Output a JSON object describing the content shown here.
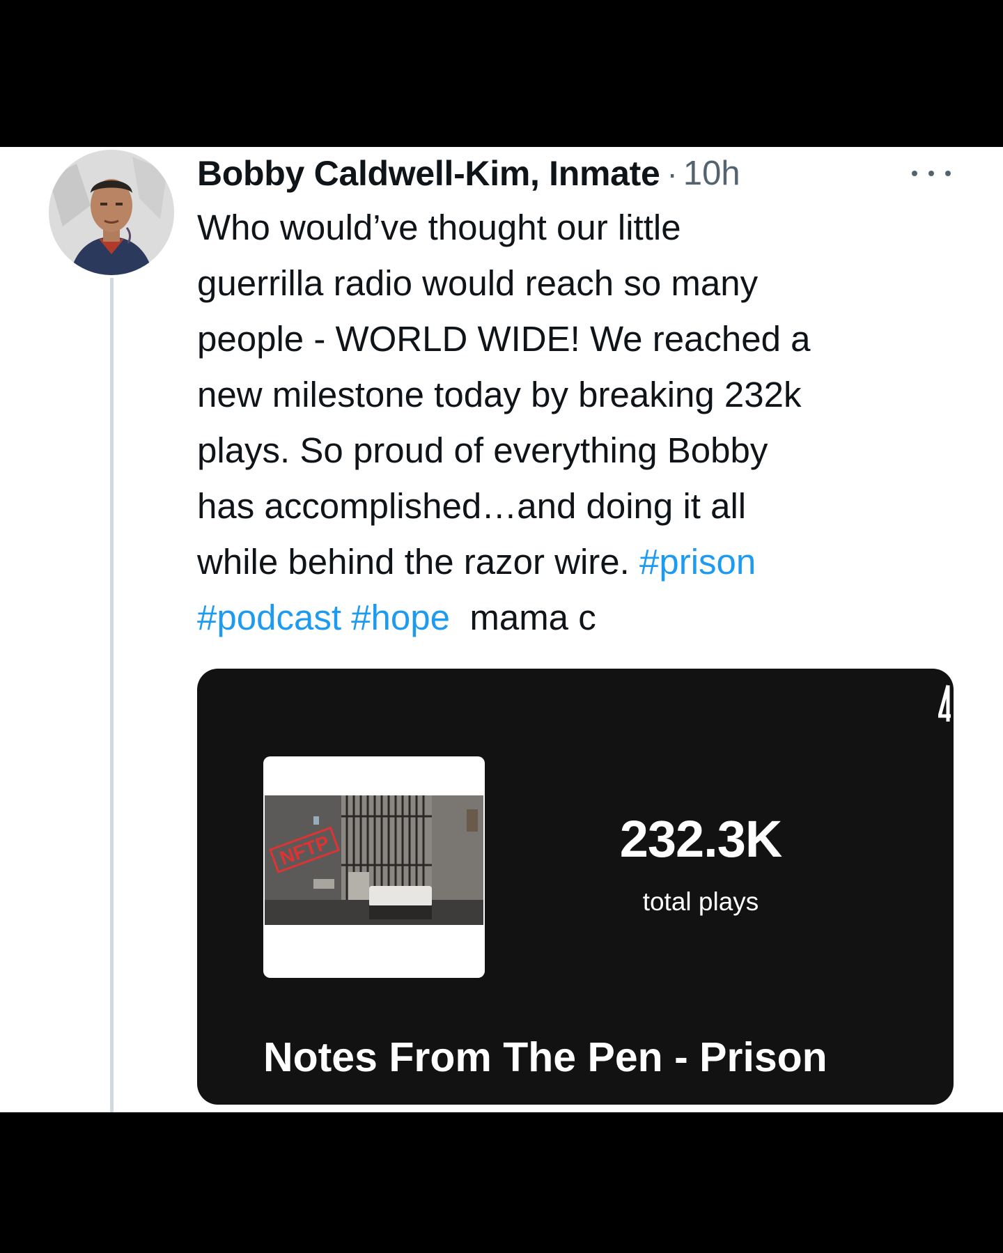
{
  "tweet": {
    "author_name": "Bobby Caldwell-Kim, Inmate",
    "separator": "·",
    "timestamp": "10h",
    "text_lines": [
      "Who would’ve thought our little",
      "guerrilla radio would reach so many",
      "people - WORLD WIDE! We reached a",
      "new milestone today by breaking 232k",
      "plays. So proud of everything Bobby",
      "has accomplished…and doing it all",
      "while behind the razor wire."
    ],
    "hashtags": [
      "#prison",
      "#podcast",
      "#hope"
    ],
    "signoff": "mama c",
    "link_color": "#1d9bf0"
  },
  "card": {
    "cover_badge": "NFTP",
    "plays_count": "232.3K",
    "plays_label": "total plays",
    "show_title": "Notes From The Pen - Prison",
    "background_color": "#121212"
  }
}
